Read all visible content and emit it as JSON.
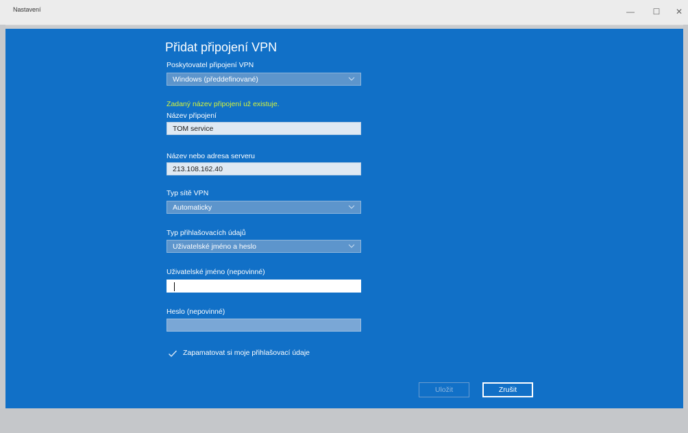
{
  "window": {
    "title": "Nastavení",
    "minimize_glyph": "—",
    "maximize_glyph": "☐",
    "close_glyph": "✕"
  },
  "dialog": {
    "heading": "Přidat připojení VPN",
    "provider_label": "Poskytovatel připojení VPN",
    "provider_value": "Windows (předdefinované)",
    "warning": "Zadaný název připojení už existuje.",
    "connection_name_label": "Název připojení",
    "connection_name_value": "TOM service",
    "server_label": "Název nebo adresa serveru",
    "server_value": "213.108.162.40",
    "vpn_type_label": "Typ sítě VPN",
    "vpn_type_value": "Automaticky",
    "signin_type_label": "Typ přihlašovacích údajů",
    "signin_type_value": "Uživatelské jméno a heslo",
    "username_label": "Uživatelské jméno (nepovinné)",
    "username_value": "",
    "password_label": "Heslo (nepovinné)",
    "password_value": "",
    "remember_label": "Zapamatovat si moje přihlašovací údaje",
    "remember_checked": true,
    "save_label": "Uložit",
    "cancel_label": "Zrušit"
  },
  "colors": {
    "dialog_bg": "#1170c7",
    "warning_text": "#d4f33b",
    "select_bg": "#5d95cc"
  },
  "icons": {
    "dropdown": "chevron-down-icon",
    "checkbox": "checkmark-icon"
  }
}
